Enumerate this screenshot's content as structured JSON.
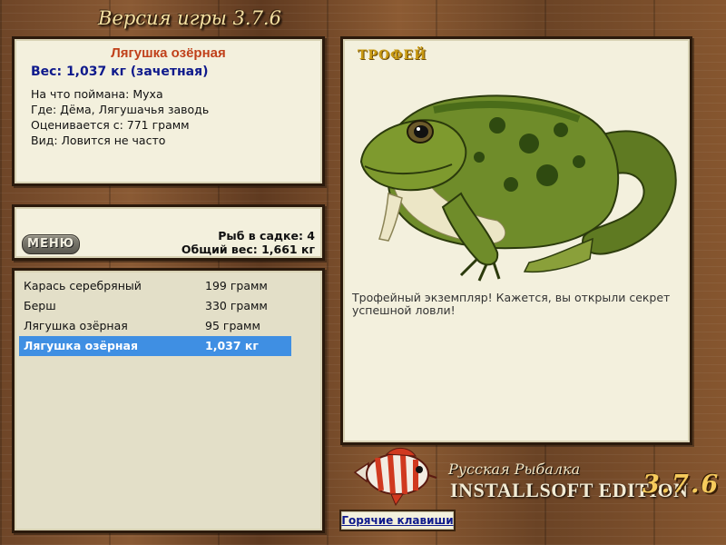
{
  "header": {
    "version_title": "Версия игры 3.7.6"
  },
  "fish_info": {
    "name": "Лягушка озёрная",
    "weight": "Вес: 1,037 кг (зачетная)",
    "caught_on": "На что поймана: Муха",
    "location": "Где: Дёма, Лягушачья заводь",
    "threshold": "Оценивается с: 771 грамм",
    "rarity": "Вид: Ловится не часто"
  },
  "status": {
    "menu_label": "МЕНЮ",
    "fish_in_net": "Рыб в садке: 4",
    "total_weight": "Общий вес: 1,661 кг"
  },
  "catch_list": [
    {
      "name": "Карась серебряный",
      "weight": "199 грамм"
    },
    {
      "name": "Берш",
      "weight": "330 грамм"
    },
    {
      "name": "Лягушка озёрная",
      "weight": "95 грамм"
    },
    {
      "name": "Лягушка озёрная",
      "weight": "1,037 кг",
      "selected": true
    }
  ],
  "trophy": {
    "label": "ТРОФЕЙ",
    "message": "Трофейный экземпляр! Кажется, вы открыли секрет успешной ловли!",
    "image": "frog-illustration"
  },
  "branding": {
    "line1": "Русская Рыбалка",
    "line2": "INSTALLSOFT EDITION",
    "version": "3.7.6",
    "logo_icon": "striped-fish-icon"
  },
  "hotkeys_label": "Горячие клавиши",
  "colors": {
    "panel_bg": "#f3f0dd",
    "fish_name": "#c0401a",
    "weight_text": "#0f1a8c",
    "selection": "#3f8fe3",
    "trophy_gold": "#c99a12"
  }
}
